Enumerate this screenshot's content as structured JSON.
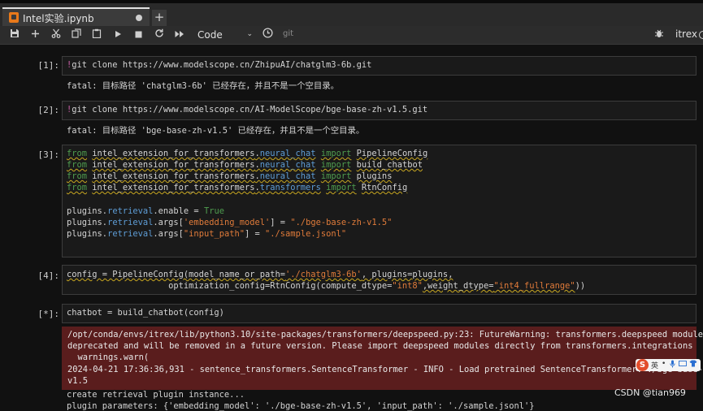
{
  "tab": {
    "title": "Intel实验.ipynb",
    "new_tab": "+"
  },
  "toolbar": {
    "save": "save-icon",
    "add": "plus-icon",
    "cut": "scissors-icon",
    "copy": "copy-icon",
    "paste": "paste-icon",
    "run": "play-icon",
    "stop": "stop-icon",
    "restart": "restart-icon",
    "run_all": "fast-forward-icon",
    "cell_type": "Code",
    "git_label": "git",
    "kernel_name": "itrex"
  },
  "cells": [
    {
      "prompt": "[1]:",
      "bang": "!",
      "code": "git clone https://www.modelscope.cn/ZhipuAI/chatglm3-6b.git",
      "output": "fatal: 目标路径 'chatglm3-6b' 已经存在，并且不是一个空目录。"
    },
    {
      "prompt": "[2]:",
      "bang": "!",
      "code": "git clone https://www.modelscope.cn/AI-ModelScope/bge-base-zh-v1.5.git",
      "output": "fatal: 目标路径 'bge-base-zh-v1.5' 已经存在，并且不是一个空目录。"
    },
    {
      "prompt": "[3]:",
      "lines": [
        {
          "k1": "from",
          "m1": "intel_extension_for_transformers",
          "d": ".",
          "m2": "neural_chat",
          "k2": "import",
          "n": "PipelineConfig"
        },
        {
          "k1": "from",
          "m1": "intel_extension_for_transformers",
          "d": ".",
          "m2": "neural_chat",
          "k2": "import",
          "n": "build_chatbot"
        },
        {
          "k1": "from",
          "m1": "intel_extension_for_transformers",
          "d": ".",
          "m2": "neural_chat",
          "k2": "import",
          "n": "plugins"
        },
        {
          "k1": "from",
          "m1": "intel_extension_for_transformers",
          "d": ".",
          "m2": "transformers",
          "k2": "import",
          "n": "RtnConfig"
        }
      ],
      "assign1": {
        "obj": "plugins",
        "attr": "retrieval",
        "tail": ".enable = ",
        "val": "True"
      },
      "assign2": {
        "obj": "plugins",
        "attr": "retrieval",
        "mid": ".args[",
        "key": "'embedding_model'",
        "eq": "] = ",
        "val": "\"./bge-base-zh-v1.5\""
      },
      "assign3": {
        "obj": "plugins",
        "attr": "retrieval",
        "mid": ".args[",
        "key": "\"input_path\"",
        "eq": "] = ",
        "val": "\"./sample.jsonl\""
      }
    },
    {
      "prompt": "[4]:",
      "l1a": "config = PipelineConfig(model_name_or_path=",
      "l1s": "'./chatglm3-6b'",
      "l1b": ", plugins=plugins,",
      "l2a": "                    optimization_config=RtnConfig(compute_dtype=",
      "l2s1": "\"int8\"",
      "l2b": ",weight_dtype=",
      "l2s2": "\"int4_fullrange\"",
      "l2c": "))"
    },
    {
      "prompt": "[*]:",
      "code": "chatbot = build_chatbot(config)",
      "stderr": [
        "/opt/conda/envs/itrex/lib/python3.10/site-packages/transformers/deepspeed.py:23: FutureWarning: transformers.deepspeed module is",
        "deprecated and will be removed in a future version. Please import deepspeed modules directly from transformers.integrations",
        "  warnings.warn(",
        "2024-04-21 17:36:36,931 - sentence_transformers.SentenceTransformer - INFO - Load pretrained SentenceTransformer: ./bge-base-zh-",
        "v1.5"
      ],
      "after": [
        "create retrieval plugin instance...",
        "plugin parameters: {'embedding_model': './bge-base-zh-v1.5', 'input_path': './sample.jsonl'}"
      ]
    }
  ],
  "ime": {
    "logo": "S",
    "label": "英"
  },
  "watermark": "CSDN @tian969"
}
